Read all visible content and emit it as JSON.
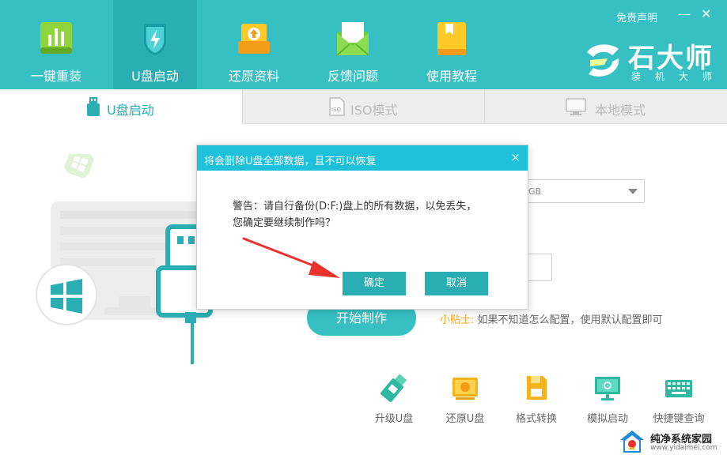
{
  "header": {
    "nav": [
      {
        "label": "一键重装",
        "icon": "bar-chart-icon"
      },
      {
        "label": "U盘启动",
        "icon": "usb-shield-icon"
      },
      {
        "label": "还原资料",
        "icon": "restore-box-icon"
      },
      {
        "label": "反馈问题",
        "icon": "envelope-icon"
      },
      {
        "label": "使用教程",
        "icon": "book-icon"
      }
    ],
    "disclaimer": "免责声明",
    "minimize": "—",
    "close": "✕",
    "brand": {
      "title": "石大师",
      "subtitle": "装机大师"
    }
  },
  "tabs": [
    {
      "label": "U盘启动",
      "icon": "usb-drive-icon"
    },
    {
      "label": "ISO模式",
      "icon": "iso-file-icon"
    },
    {
      "label": "本地模式",
      "icon": "monitor-icon"
    }
  ],
  "main": {
    "select_value_fragment": "GB",
    "start_button": "开始制作",
    "tip_label": "小贴士:",
    "tip_text": "如果不知道怎么配置，使用默认配置即可"
  },
  "tools": [
    {
      "label": "升级U盘",
      "icon": "usb-upgrade-icon"
    },
    {
      "label": "还原U盘",
      "icon": "usb-restore-icon"
    },
    {
      "label": "格式转换",
      "icon": "format-convert-icon"
    },
    {
      "label": "模拟启动",
      "icon": "simulate-boot-icon"
    },
    {
      "label": "快捷键查询",
      "icon": "keyboard-icon"
    }
  ],
  "dialog": {
    "title": "将会删除U盘全部数据，且不可以恢复",
    "message_line1": "警告：请自行备份(D:F:)盘上的所有数据，以免丢失，",
    "message_line2": "您确定要继续制作吗？",
    "confirm": "确定",
    "cancel": "取消",
    "close": "×"
  },
  "watermark": {
    "title": "纯净系统家园",
    "url": "www.yidaimei.com"
  },
  "colors": {
    "primary": "#36c0c4",
    "primary_dark": "#2aaeb3",
    "dialog_header": "#1fc0d9",
    "tip_accent": "#f5a623",
    "annotation_arrow": "#e8322e"
  }
}
